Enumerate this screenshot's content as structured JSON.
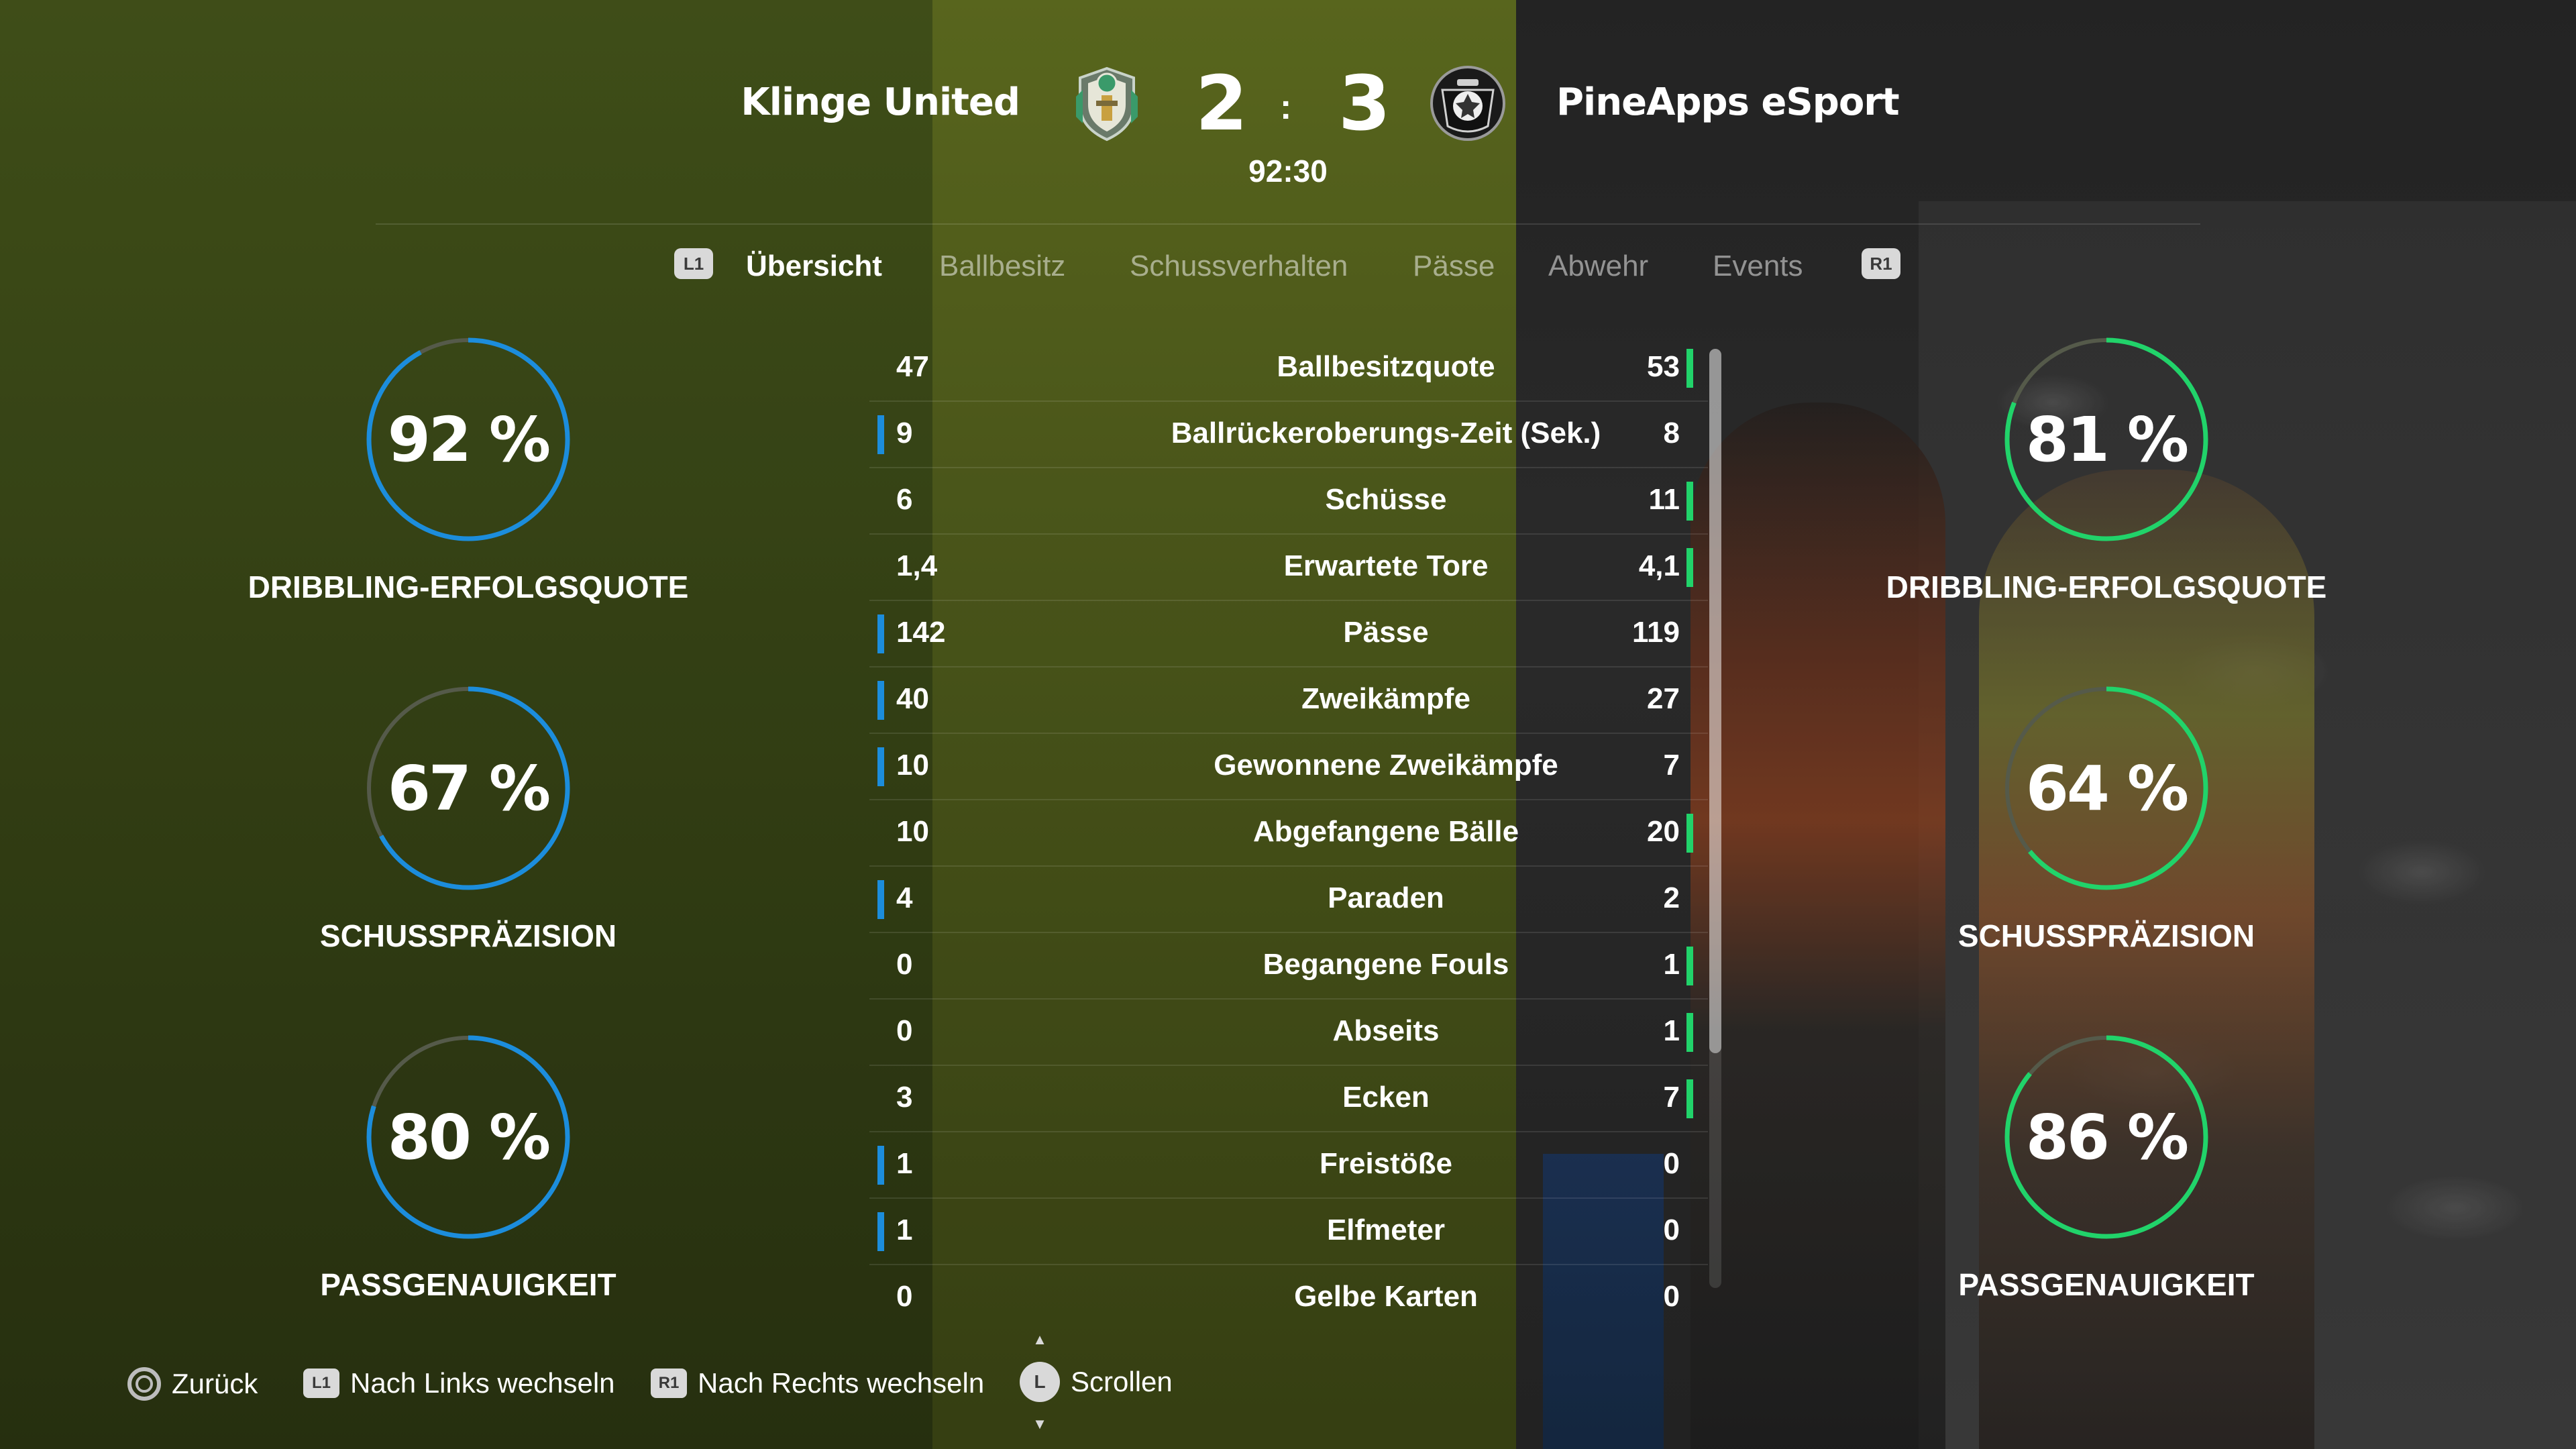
{
  "match": {
    "home_team": "Klinge United",
    "away_team": "PineApps eSport",
    "home_score": "2",
    "away_score": "3",
    "score_separator": ":",
    "clock": "92:30",
    "home_crest_icon": "klinge-united-crest",
    "away_crest_icon": "pineapps-crest"
  },
  "tabs": {
    "left_button": "L1",
    "right_button": "R1",
    "items": [
      "Übersicht",
      "Ballbesitz",
      "Schussverhalten",
      "Pässe",
      "Abwehr",
      "Events"
    ],
    "active": "Übersicht"
  },
  "colors": {
    "home_accent": "#1c8ddc",
    "away_accent": "#21d36a",
    "ring_track": "#555a4a"
  },
  "home_rings": [
    {
      "value": "92 %",
      "percent": 92,
      "label": "DRIBBLING-ERFOLGSQUOTE"
    },
    {
      "value": "67 %",
      "percent": 67,
      "label": "SCHUSSPRÄZISION"
    },
    {
      "value": "80 %",
      "percent": 80,
      "label": "PASSGENAUIGKEIT"
    }
  ],
  "away_rings": [
    {
      "value": "81 %",
      "percent": 81,
      "label": "DRIBBLING-ERFOLGSQUOTE"
    },
    {
      "value": "64 %",
      "percent": 64,
      "label": "SCHUSSPRÄZISION"
    },
    {
      "value": "86 %",
      "percent": 86,
      "label": "PASSGENAUIGKEIT"
    }
  ],
  "stats": [
    {
      "home": "47",
      "name": "Ballbesitzquote",
      "away": "53",
      "leader": "away"
    },
    {
      "home": "9",
      "name": "Ballrückeroberungs-Zeit (Sek.)",
      "away": "8",
      "leader": "home"
    },
    {
      "home": "6",
      "name": "Schüsse",
      "away": "11",
      "leader": "away"
    },
    {
      "home": "1,4",
      "name": "Erwartete Tore",
      "away": "4,1",
      "leader": "away"
    },
    {
      "home": "142",
      "name": "Pässe",
      "away": "119",
      "leader": "home"
    },
    {
      "home": "40",
      "name": "Zweikämpfe",
      "away": "27",
      "leader": "home"
    },
    {
      "home": "10",
      "name": "Gewonnene Zweikämpfe",
      "away": "7",
      "leader": "home"
    },
    {
      "home": "10",
      "name": "Abgefangene Bälle",
      "away": "20",
      "leader": "away"
    },
    {
      "home": "4",
      "name": "Paraden",
      "away": "2",
      "leader": "home"
    },
    {
      "home": "0",
      "name": "Begangene Fouls",
      "away": "1",
      "leader": "away"
    },
    {
      "home": "0",
      "name": "Abseits",
      "away": "1",
      "leader": "away"
    },
    {
      "home": "3",
      "name": "Ecken",
      "away": "7",
      "leader": "away"
    },
    {
      "home": "1",
      "name": "Freistöße",
      "away": "0",
      "leader": "home"
    },
    {
      "home": "1",
      "name": "Elfmeter",
      "away": "0",
      "leader": "home"
    },
    {
      "home": "0",
      "name": "Gelbe Karten",
      "away": "0",
      "leader": "none"
    }
  ],
  "footer": {
    "back": {
      "button": "circle",
      "label": "Zurück"
    },
    "left": {
      "button": "L1",
      "label": "Nach Links wechseln"
    },
    "right": {
      "button": "R1",
      "label": "Nach Rechts wechseln"
    },
    "scroll": {
      "button": "L",
      "label": "Scrollen"
    }
  }
}
